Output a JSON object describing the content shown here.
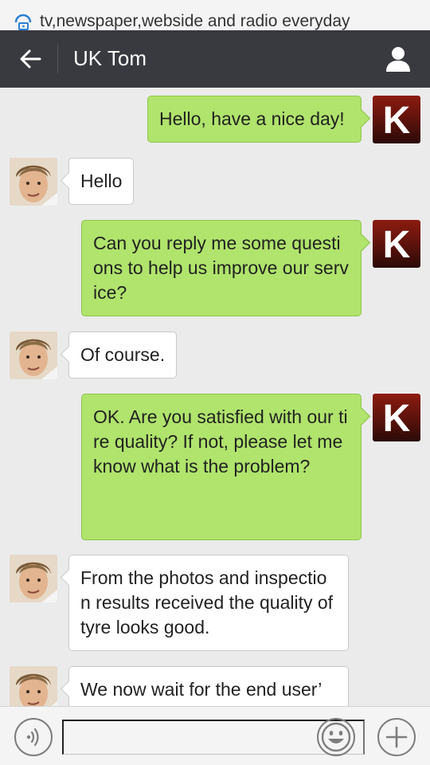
{
  "status_bar": {
    "ticker_text": "tv,newspaper,webside and radio everyday"
  },
  "app_bar": {
    "title": "UK Tom"
  },
  "messages": [
    {
      "side": "out",
      "text": "Hello, have a nice day!"
    },
    {
      "side": "in",
      "text": "Hello"
    },
    {
      "side": "out",
      "text": "Can you reply me some questions to help us improve our service?"
    },
    {
      "side": "in",
      "text": "Of course."
    },
    {
      "side": "out",
      "text": "OK. Are you satisfied with our tire quality? If not, please let me know what is the problem?"
    },
    {
      "side": "in",
      "text": "From the photos and inspection results received the quality of tyre looks good."
    },
    {
      "side": "in",
      "text": "We now wait for the end user’"
    }
  ],
  "avatars": {
    "self_letter": "K"
  },
  "input": {
    "placeholder": "",
    "value": ""
  },
  "colors": {
    "app_bar": "#393a3f",
    "outgoing_bubble": "#b0e46c",
    "incoming_bubble": "#ffffff",
    "chat_bg": "#ebebeb",
    "brand_k": "#8c1c10"
  }
}
